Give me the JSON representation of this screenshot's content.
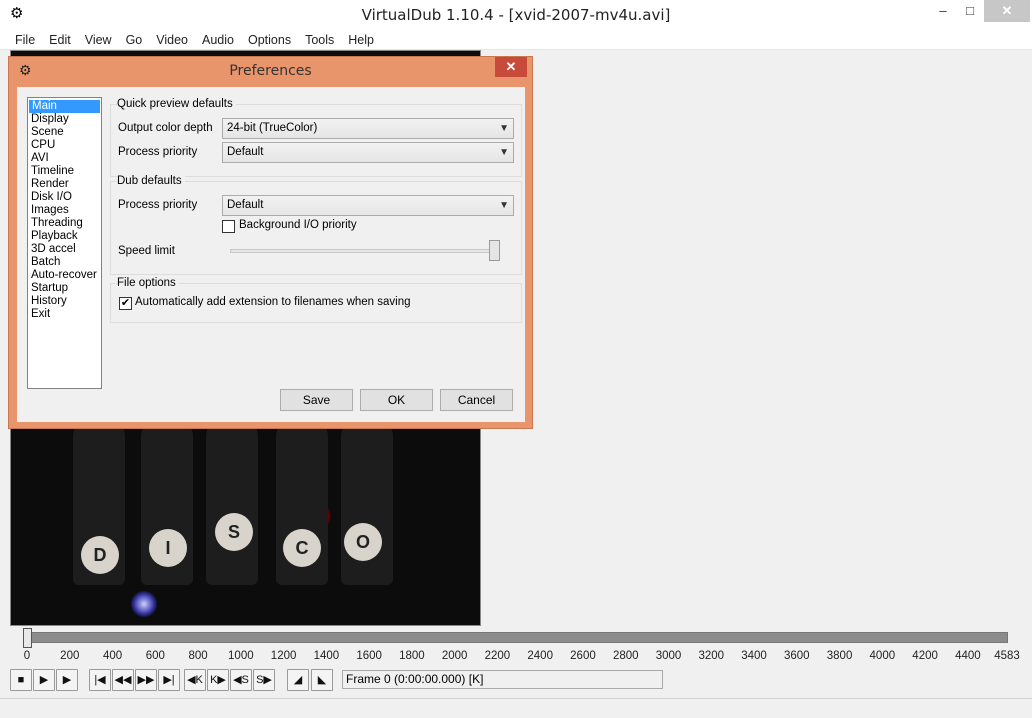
{
  "window": {
    "title": "VirtualDub 1.10.4 - [xvid-2007-mv4u.avi]",
    "app_icon": "gear-icon",
    "controls": {
      "minimize": "–",
      "maximize": "□",
      "close": "✕"
    }
  },
  "menu": [
    "File",
    "Edit",
    "View",
    "Go",
    "Video",
    "Audio",
    "Options",
    "Tools",
    "Help"
  ],
  "video": {
    "ball_letters": [
      "D",
      "I",
      "S",
      "C",
      "O"
    ]
  },
  "timeline": {
    "position_frames": 0,
    "max_frames": 4583,
    "ticks": [
      "0",
      "200",
      "400",
      "600",
      "800",
      "1000",
      "1200",
      "1400",
      "1600",
      "1800",
      "2000",
      "2200",
      "2400",
      "2600",
      "2800",
      "3000",
      "3200",
      "3400",
      "3600",
      "3800",
      "4000",
      "4200",
      "4400",
      "4583"
    ]
  },
  "toolbar": {
    "buttons": [
      {
        "name": "stop-button",
        "icon": "stop-icon",
        "glyph": "■"
      },
      {
        "name": "play-input-button",
        "icon": "play-input-icon",
        "glyph": "▶"
      },
      {
        "name": "play-output-button",
        "icon": "play-output-icon",
        "glyph": "▶"
      },
      {
        "name": "go-start-button",
        "icon": "go-start-icon",
        "glyph": "|◀"
      },
      {
        "name": "step-back-button",
        "icon": "step-back-icon",
        "glyph": "◀◀"
      },
      {
        "name": "step-forward-button",
        "icon": "step-forward-icon",
        "glyph": "▶▶"
      },
      {
        "name": "go-end-button",
        "icon": "go-end-icon",
        "glyph": "▶|"
      },
      {
        "name": "prev-keyframe-button",
        "icon": "prev-keyframe-icon",
        "glyph": "◀K"
      },
      {
        "name": "next-keyframe-button",
        "icon": "next-keyframe-icon",
        "glyph": "K▶"
      },
      {
        "name": "scene-back-button",
        "icon": "scene-back-icon",
        "glyph": "◀S"
      },
      {
        "name": "scene-forward-button",
        "icon": "scene-forward-icon",
        "glyph": "S▶"
      },
      {
        "name": "mark-in-button",
        "icon": "mark-in-icon",
        "glyph": "◢"
      },
      {
        "name": "mark-out-button",
        "icon": "mark-out-icon",
        "glyph": "◣"
      }
    ],
    "frame_readout": "Frame 0 (0:00:00.000) [K]"
  },
  "preferences": {
    "title": "Preferences",
    "icon": "gear-icon",
    "close_glyph": "✕",
    "categories": [
      "Main",
      "Display",
      "Scene",
      "CPU",
      "AVI",
      "Timeline",
      "Render",
      "Disk I/O",
      "Images",
      "Threading",
      "Playback",
      "3D accel",
      "Batch",
      "Auto-recover",
      "Startup",
      "History",
      "Exit"
    ],
    "selected_category": "Main",
    "quick_preview": {
      "group_label": "Quick preview defaults",
      "output_color_depth_label": "Output color depth",
      "output_color_depth_value": "24-bit (TrueColor)",
      "process_priority_label": "Process priority",
      "process_priority_value": "Default"
    },
    "dub_defaults": {
      "group_label": "Dub defaults",
      "process_priority_label": "Process priority",
      "process_priority_value": "Default",
      "background_io_label": "Background I/O priority",
      "background_io_checked": false,
      "speed_limit_label": "Speed limit",
      "speed_limit_fraction": 1.0
    },
    "file_options": {
      "group_label": "File options",
      "auto_extension_label": "Automatically add extension to filenames when saving",
      "auto_extension_checked": true
    },
    "buttons": {
      "save": "Save",
      "ok": "OK",
      "cancel": "Cancel"
    }
  },
  "colors": {
    "dialog_frame": "#e9956c",
    "selection": "#3399ff",
    "close_red": "#c74a3a"
  }
}
